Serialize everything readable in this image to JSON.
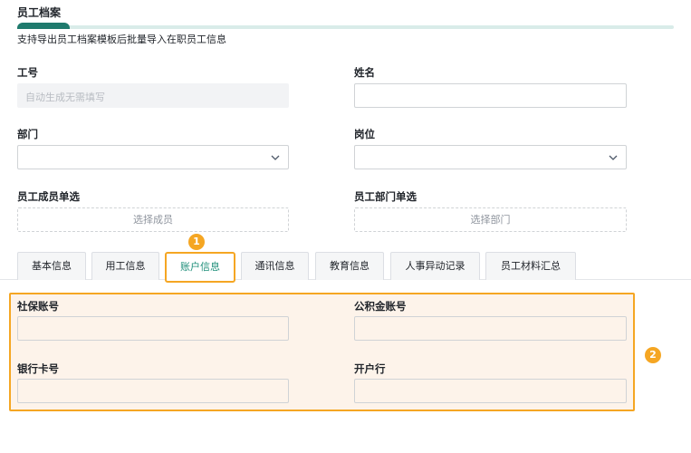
{
  "header": {
    "title": "员工档案",
    "description": "支持导出员工档案模板后批量导入在职员工信息"
  },
  "form": {
    "employee_id_label": "工号",
    "employee_id_placeholder": "自动生成无需填写",
    "name_label": "姓名",
    "department_label": "部门",
    "position_label": "岗位",
    "member_select_label": "员工成员单选",
    "member_select_button": "选择成员",
    "dept_select_label": "员工部门单选",
    "dept_select_button": "选择部门"
  },
  "tabs": [
    {
      "label": "基本信息"
    },
    {
      "label": "用工信息"
    },
    {
      "label": "账户信息"
    },
    {
      "label": "通讯信息"
    },
    {
      "label": "教育信息"
    },
    {
      "label": "人事异动记录"
    },
    {
      "label": "员工材料汇总"
    }
  ],
  "active_tab": "账户信息",
  "account": {
    "social_security_label": "社保账号",
    "housing_fund_label": "公积金账号",
    "bank_card_label": "银行卡号",
    "bank_label": "开户行"
  },
  "badges": {
    "one": "1",
    "two": "2"
  },
  "colors": {
    "accent": "#1f7a6d",
    "highlight": "#f5a623",
    "highlight_bg": "#fdf3ea"
  }
}
